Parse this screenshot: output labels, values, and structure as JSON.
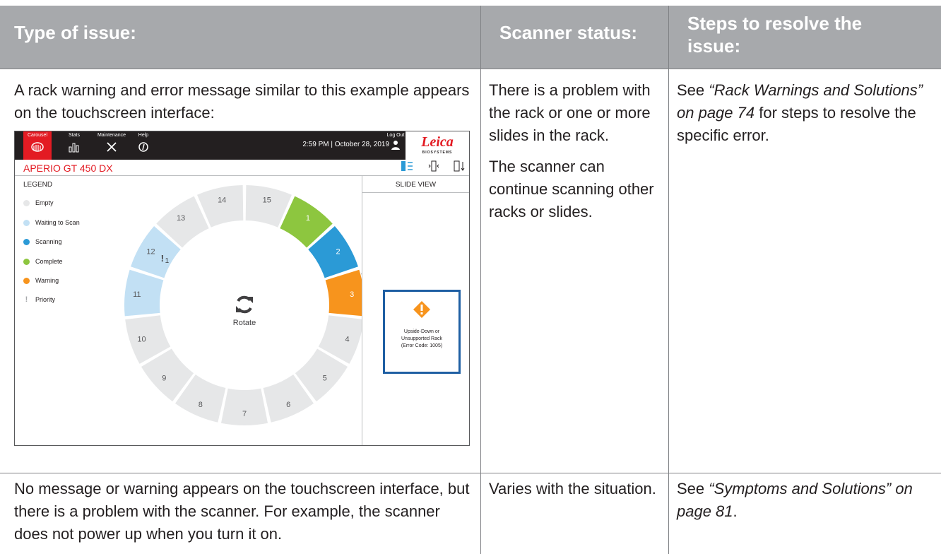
{
  "table": {
    "headers": [
      "Type of issue:",
      "Scanner status:",
      "Steps to resolve the issue:"
    ],
    "rows": [
      {
        "issue": "A rack warning and error message similar to this example appears on the touchscreen interface:",
        "status": [
          "There is a problem with the rack or one or more slides in the rack.",
          "The scanner can continue scanning other racks or slides."
        ],
        "steps_prefix": "See ",
        "steps_link": "“Rack Warnings and Solutions” on page 74",
        "steps_suffix": " for steps to resolve the specific error."
      },
      {
        "issue": "No message or warning appears on the touchscreen interface, but there is a problem with the scanner. For example, the scanner does not power up when you turn it on.",
        "status": [
          "Varies with the situation."
        ],
        "steps_prefix": "See ",
        "steps_link": "“Symptoms and Solutions” on page 81",
        "steps_suffix": "."
      }
    ]
  },
  "touchscreen": {
    "tabs": [
      {
        "label": "Carousel",
        "icon": "carousel-icon"
      },
      {
        "label": "Stats",
        "icon": "stats-icon"
      },
      {
        "label": "Maintenance",
        "icon": "maintenance-icon"
      },
      {
        "label": "Help",
        "icon": "help-icon"
      }
    ],
    "time": "2:59 PM  |  October 28, 2019",
    "logout": "Log Out",
    "brand": "Leica",
    "brand_sub": "BIOSYSTEMS",
    "model": "APERIO GT 450 DX",
    "legend_title": "LEGEND",
    "legend": [
      {
        "label": "Empty",
        "color": "#e6e7e8"
      },
      {
        "label": "Waiting to Scan",
        "color": "#c2e0f4"
      },
      {
        "label": "Scanning",
        "color": "#2b9ad6"
      },
      {
        "label": "Complete",
        "color": "#8dc63f"
      },
      {
        "label": "Warning",
        "color": "#f7941d"
      },
      {
        "label": "Priority",
        "color": "#a7a9ac"
      }
    ],
    "rotate_label": "Rotate",
    "slide_view_title": "SLIDE VIEW",
    "error_lines": [
      "Upside-Down or",
      "Unsupported Rack",
      "(Error Code: 1005)"
    ],
    "priority_marker": "1",
    "racks": [
      {
        "n": "1",
        "state": "complete"
      },
      {
        "n": "2",
        "state": "scanning"
      },
      {
        "n": "3",
        "state": "warning"
      },
      {
        "n": "4",
        "state": "empty"
      },
      {
        "n": "5",
        "state": "empty"
      },
      {
        "n": "6",
        "state": "empty"
      },
      {
        "n": "7",
        "state": "empty"
      },
      {
        "n": "8",
        "state": "empty"
      },
      {
        "n": "9",
        "state": "empty"
      },
      {
        "n": "10",
        "state": "empty"
      },
      {
        "n": "11",
        "state": "waiting"
      },
      {
        "n": "12",
        "state": "waiting"
      },
      {
        "n": "13",
        "state": "empty"
      },
      {
        "n": "14",
        "state": "empty"
      },
      {
        "n": "15",
        "state": "empty"
      }
    ],
    "colors": {
      "accent": "#e31b23",
      "header_gray": "#a7a9ac",
      "error_border": "#1f5fa3",
      "warning_icon": "#f7941d"
    }
  }
}
